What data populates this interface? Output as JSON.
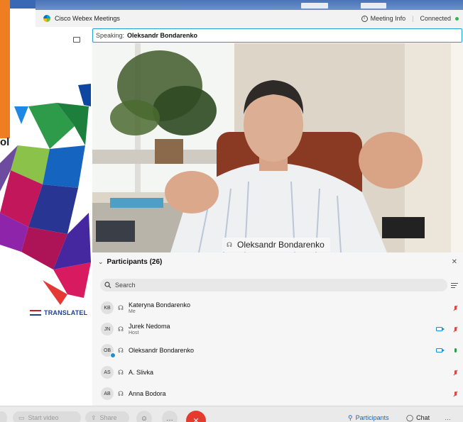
{
  "app": {
    "title": "Cisco Webex Meetings",
    "meeting_info_label": "Meeting Info",
    "connection_status": "Connected"
  },
  "background_slide": {
    "partial_text": "ol",
    "logo_text": "TRANSLATEL"
  },
  "speaking_bar": {
    "label": "Speaking:",
    "name": "Oleksandr Bondarenko"
  },
  "video": {
    "name_label": "Oleksandr Bondarenko"
  },
  "participants_panel": {
    "title": "Participants (26)",
    "search_placeholder": "Search",
    "participants": [
      {
        "initials": "KB",
        "name": "Kateryna Bondarenko",
        "role": "Me",
        "camera": false,
        "mic": "muted",
        "presenting_badge": false
      },
      {
        "initials": "JN",
        "name": "Jurek Nedoma",
        "role": "Host",
        "camera": true,
        "mic": "muted",
        "presenting_badge": false
      },
      {
        "initials": "OB",
        "name": "Oleksandr Bondarenko",
        "role": "",
        "camera": true,
        "mic": "on",
        "presenting_badge": true
      },
      {
        "initials": "AS",
        "name": "A. Slivka",
        "role": "",
        "camera": false,
        "mic": "muted",
        "presenting_badge": false
      },
      {
        "initials": "AB",
        "name": "Anna Bodora",
        "role": "",
        "camera": false,
        "mic": "muted",
        "presenting_badge": false
      }
    ]
  },
  "controls": {
    "start_video_label": "Start video",
    "share_label": "Share",
    "participants_label": "Participants",
    "chat_label": "Chat"
  },
  "colors": {
    "accent": "#1467bd",
    "speaking_border": "#21a0d2",
    "end_call": "#e33b2e",
    "connected": "#2eb84b",
    "muted": "#dd4444",
    "brand_orange": "#ef7d22"
  },
  "icons": [
    "webex-logo-icon",
    "info-icon",
    "layout-icon",
    "headset-icon",
    "search-icon",
    "sort-icon",
    "close-icon",
    "camera-icon",
    "mic-icon",
    "mic-muted-icon",
    "end-call-icon",
    "more-icon",
    "participants-icon",
    "chat-icon"
  ]
}
